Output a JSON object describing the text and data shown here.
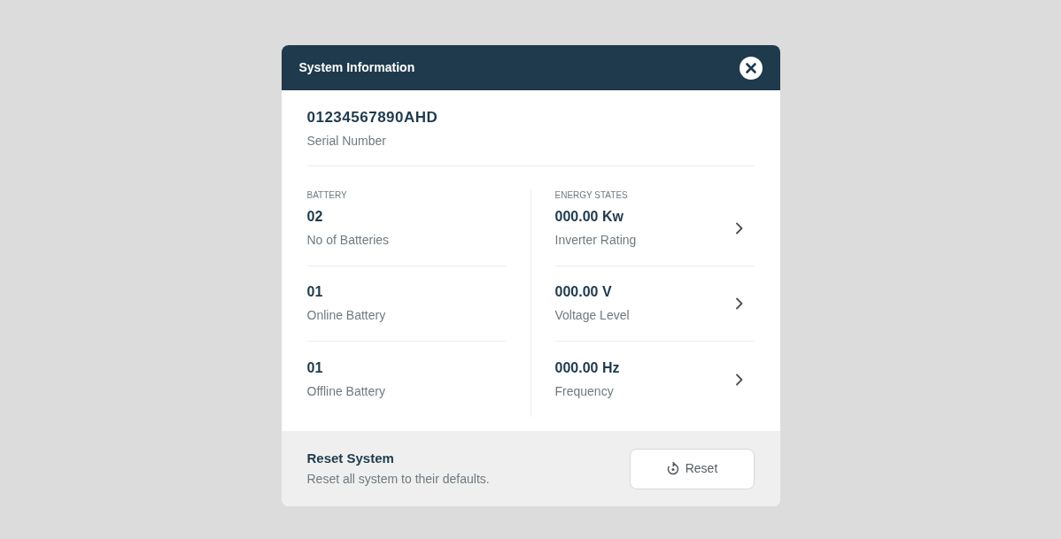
{
  "dialog": {
    "title": "System Information"
  },
  "serial": {
    "value": "01234567890AHD",
    "label": "Serial Number"
  },
  "battery": {
    "heading": "BATTERY",
    "items": [
      {
        "value": "02",
        "label": "No of Batteries"
      },
      {
        "value": "01",
        "label": "Online Battery"
      },
      {
        "value": "01",
        "label": "Offline Battery"
      }
    ]
  },
  "energy_states": {
    "heading": "ENERGY STATES",
    "items": [
      {
        "value": "000.00 Kw",
        "label": "Inverter Rating"
      },
      {
        "value": "000.00 V",
        "label": "Voltage Level"
      },
      {
        "value": "000.00 Hz",
        "label": "Frequency"
      }
    ]
  },
  "reset": {
    "title": "Reset System",
    "description": "Reset all system to their defaults.",
    "button": "Reset"
  }
}
